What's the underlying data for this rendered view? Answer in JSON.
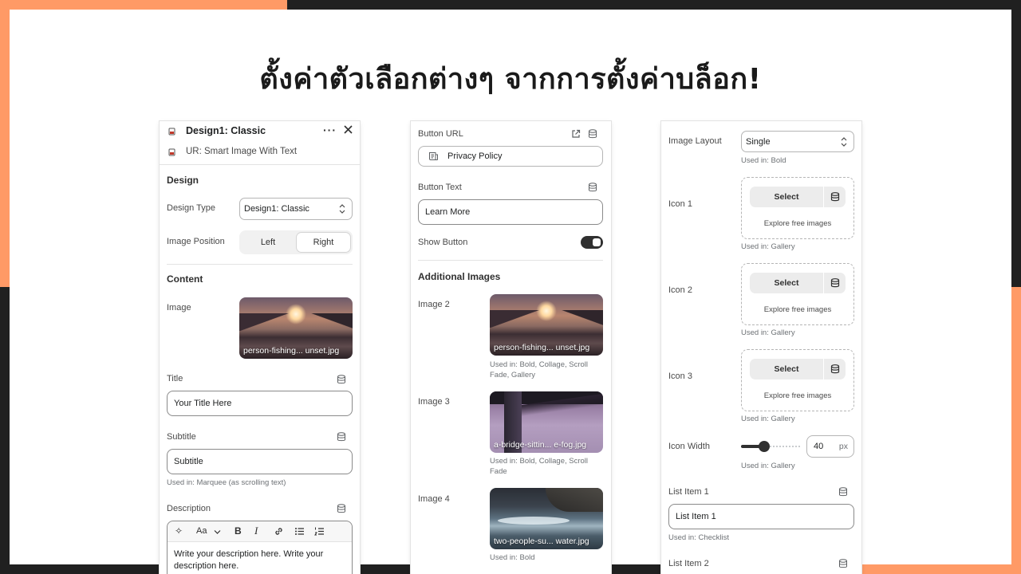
{
  "headline": "ตั้งค่าตัวเลือกต่างๆ จากการตั้งค่าบล็อก!",
  "colors": {
    "accent_orange": "#ff9a66",
    "dark": "#202020"
  },
  "panel1": {
    "header_title": "Design1: Classic",
    "header_subtitle": "UR: Smart Image With Text",
    "design_section": "Design",
    "design_type_label": "Design Type",
    "design_type_value": "Design1: Classic",
    "image_position_label": "Image Position",
    "image_position_options": [
      "Left",
      "Right"
    ],
    "image_position_selected": "Right",
    "content_section": "Content",
    "image_label": "Image",
    "image_caption": "person-fishing... unset.jpg",
    "title_label": "Title",
    "title_value": "Your Title Here",
    "subtitle_label": "Subtitle",
    "subtitle_value": "Subtitle",
    "subtitle_used": "Used in: Marquee (as scrolling text)",
    "description_label": "Description",
    "toolbar_font": "Aa",
    "description_value": "Write your description here. Write your description here."
  },
  "panel2": {
    "button_url_label": "Button URL",
    "button_url_value": "Privacy Policy",
    "button_text_label": "Button Text",
    "button_text_value": "Learn More",
    "show_button_label": "Show Button",
    "show_button_on": true,
    "additional_images_section": "Additional Images",
    "images": [
      {
        "label": "Image 2",
        "caption": "person-fishing... unset.jpg",
        "used": "Used in: Bold, Collage, Scroll Fade, Gallery"
      },
      {
        "label": "Image 3",
        "caption": "a-bridge-sittin... e-fog.jpg",
        "used": "Used in: Bold, Collage, Scroll Fade"
      },
      {
        "label": "Image 4",
        "caption": "two-people-su... water.jpg",
        "used": "Used in: Bold"
      }
    ]
  },
  "panel3": {
    "image_layout_label": "Image Layout",
    "image_layout_value": "Single",
    "image_layout_used": "Used in: Bold",
    "icons": [
      {
        "label": "Icon 1",
        "select": "Select",
        "explore": "Explore free images",
        "used": "Used in: Gallery"
      },
      {
        "label": "Icon 2",
        "select": "Select",
        "explore": "Explore free images",
        "used": "Used in: Gallery"
      },
      {
        "label": "Icon 3",
        "select": "Select",
        "explore": "Explore free images",
        "used": "Used in: Gallery"
      }
    ],
    "icon_width_label": "Icon Width",
    "icon_width_value": "40",
    "icon_width_unit": "px",
    "icon_width_slider_fraction": 0.36,
    "icon_width_used": "Used in: Gallery",
    "list_item1_label": "List Item 1",
    "list_item1_value": "List Item 1",
    "list_item1_used": "Used in: Checklist",
    "list_item2_label": "List Item 2"
  }
}
